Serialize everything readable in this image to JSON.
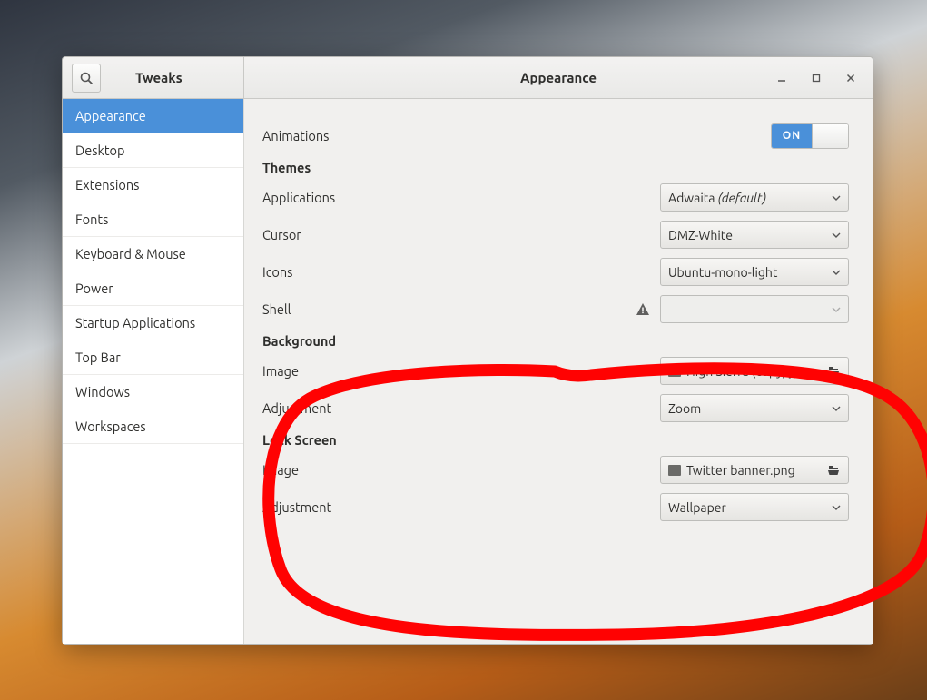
{
  "header": {
    "app_title": "Tweaks",
    "panel_title": "Appearance"
  },
  "sidebar": {
    "items": [
      {
        "label": "Appearance",
        "selected": true
      },
      {
        "label": "Desktop"
      },
      {
        "label": "Extensions"
      },
      {
        "label": "Fonts"
      },
      {
        "label": "Keyboard & Mouse"
      },
      {
        "label": "Power"
      },
      {
        "label": "Startup Applications"
      },
      {
        "label": "Top Bar"
      },
      {
        "label": "Windows"
      },
      {
        "label": "Workspaces"
      }
    ]
  },
  "content": {
    "animations": {
      "label": "Animations",
      "value": "ON"
    },
    "themes_section": "Themes",
    "applications": {
      "label": "Applications",
      "value": "Adwaita",
      "suffix": " (default)"
    },
    "cursor": {
      "label": "Cursor",
      "value": "DMZ-White"
    },
    "icons": {
      "label": "Icons",
      "value": "Ubuntu-mono-light"
    },
    "shell": {
      "label": "Shell",
      "value": ""
    },
    "background_section": "Background",
    "bg_image": {
      "label": "Image",
      "value": "High Sierra (copy).jpg"
    },
    "bg_adjust": {
      "label": "Adjustment",
      "value": "Zoom"
    },
    "lockscreen_section": "Lock Screen",
    "ls_image": {
      "label": "Image",
      "value": "Twitter banner.png"
    },
    "ls_adjust": {
      "label": "Adjustment",
      "value": "Wallpaper"
    }
  },
  "icons": {
    "search": "search-icon",
    "minimize": "minimize-icon",
    "maximize": "maximize-icon",
    "close": "close-icon",
    "chevron_down": "chevron-down-icon",
    "warning": "warning-icon",
    "open": "open-icon"
  },
  "colors": {
    "accent": "#4a90d9",
    "annotation": "#ff0000"
  }
}
